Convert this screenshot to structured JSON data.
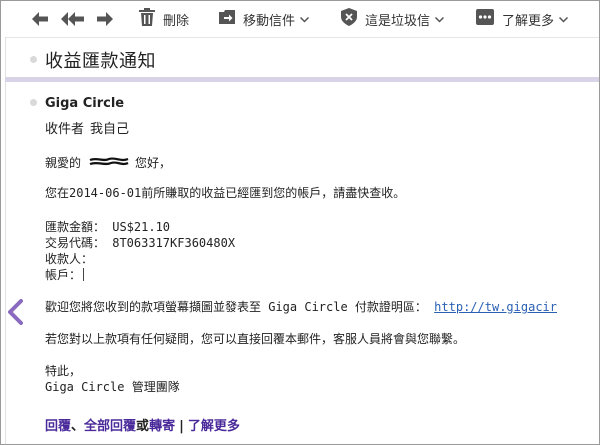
{
  "toolbar": {
    "delete_label": "刪除",
    "move_label": "移動信件",
    "spam_label": "這是垃圾信",
    "more_label": "了解更多"
  },
  "email": {
    "subject": "收益匯款通知",
    "sender": "Giga Circle",
    "recipient_label": "收件者",
    "recipient_value": "我自己",
    "greeting_prefix": "親愛的",
    "greeting_suffix": "您好，",
    "line_received": "您在2014-06-01前所賺取的收益已經匯到您的帳戶，請盡快查收。",
    "amount": "匯款金額： US$21.10",
    "transaction": "交易代碼： 8T063317KF360480X",
    "payee": "收款人：",
    "account": "帳戶：",
    "welcome": "歡迎您將您收到的款項螢幕擷圖並發表至 Giga Circle 付款證明區：",
    "link": "http://tw.gigacir",
    "questions": "若您對以上款項有任何疑問，您可以直接回覆本郵件，客服人員將會與您聯繫。",
    "closing": "特此，",
    "signature": "Giga Circle 管理團隊"
  },
  "footer": {
    "reply": "回覆",
    "sep1": "、",
    "reply_all": "全部回覆",
    "or": "或",
    "forward": "轉寄",
    "divider": "|",
    "more": "了解更多"
  }
}
